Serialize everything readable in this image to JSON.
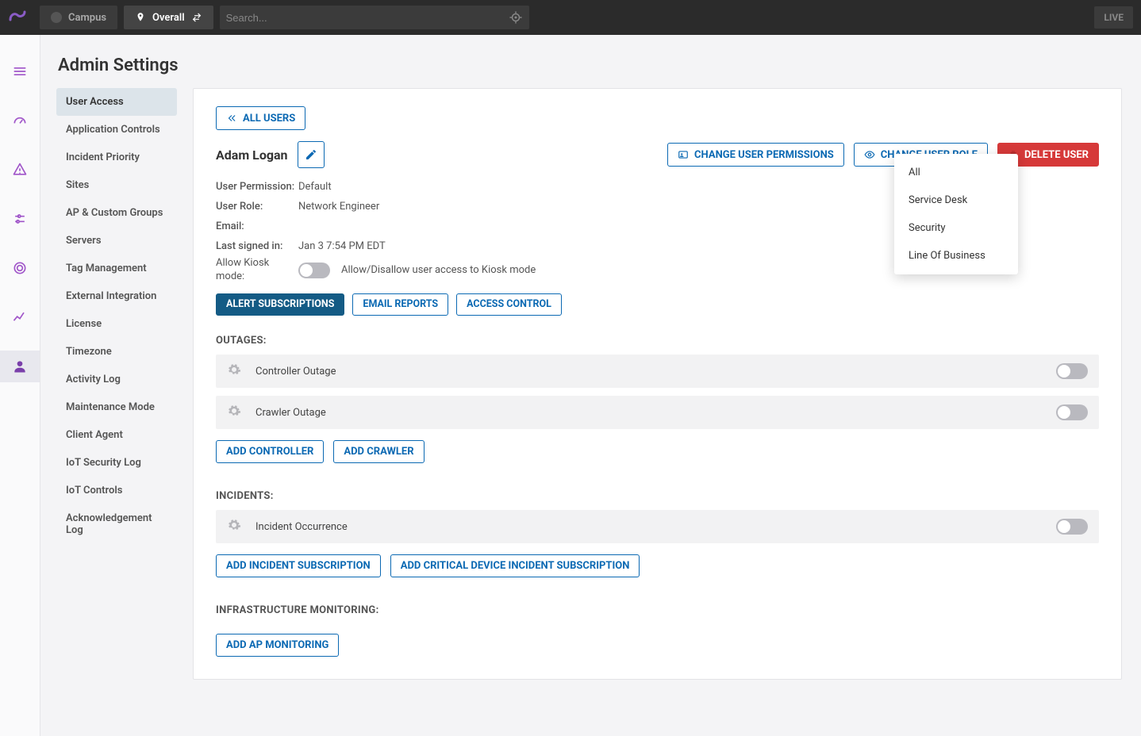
{
  "topbar": {
    "campus_label": "Campus",
    "overall_label": "Overall",
    "search_placeholder": "Search...",
    "live_label": "LIVE"
  },
  "page_title": "Admin Settings",
  "sidebar": {
    "items": [
      {
        "label": "User Access",
        "active": true
      },
      {
        "label": "Application Controls"
      },
      {
        "label": "Incident Priority"
      },
      {
        "label": "Sites"
      },
      {
        "label": "AP & Custom Groups"
      },
      {
        "label": "Servers"
      },
      {
        "label": "Tag Management"
      },
      {
        "label": "External Integration"
      },
      {
        "label": "License"
      },
      {
        "label": "Timezone"
      },
      {
        "label": "Activity Log"
      },
      {
        "label": "Maintenance Mode"
      },
      {
        "label": "Client Agent"
      },
      {
        "label": "IoT Security Log"
      },
      {
        "label": "IoT Controls"
      },
      {
        "label": "Acknowledgement Log"
      }
    ]
  },
  "panel": {
    "all_users_label": "ALL USERS",
    "user_name": "Adam Logan",
    "change_permissions_label": "CHANGE USER PERMISSIONS",
    "change_role_label": "CHANGE USER ROLE",
    "delete_user_label": "DELETE USER",
    "info": {
      "permission_label": "User Permission:",
      "permission_value": "Default",
      "role_label": "User Role:",
      "role_value": "Network Engineer",
      "email_label": "Email:",
      "email_value": "",
      "last_signed_label": "Last signed in:",
      "last_signed_value": "Jan 3 7:54 PM EDT",
      "kiosk_label": "Allow Kiosk mode:",
      "kiosk_hint": "Allow/Disallow user access to Kiosk mode"
    },
    "tabs": {
      "alert_subscriptions": "ALERT SUBSCRIPTIONS",
      "email_reports": "EMAIL REPORTS",
      "access_control": "ACCESS CONTROL"
    },
    "outages": {
      "section_label": "OUTAGES:",
      "rows": [
        {
          "label": "Controller Outage"
        },
        {
          "label": "Crawler Outage"
        }
      ],
      "add_controller": "ADD CONTROLLER",
      "add_crawler": "ADD CRAWLER"
    },
    "incidents": {
      "section_label": "INCIDENTS:",
      "rows": [
        {
          "label": "Incident Occurrence"
        }
      ],
      "add_incident": "ADD INCIDENT SUBSCRIPTION",
      "add_critical": "ADD CRITICAL DEVICE INCIDENT SUBSCRIPTION"
    },
    "infra": {
      "section_label": "INFRASTRUCTURE MONITORING:",
      "add_ap": "ADD AP MONITORING"
    },
    "role_dropdown": {
      "options": [
        "All",
        "Service Desk",
        "Security",
        "Line Of Business"
      ]
    }
  }
}
